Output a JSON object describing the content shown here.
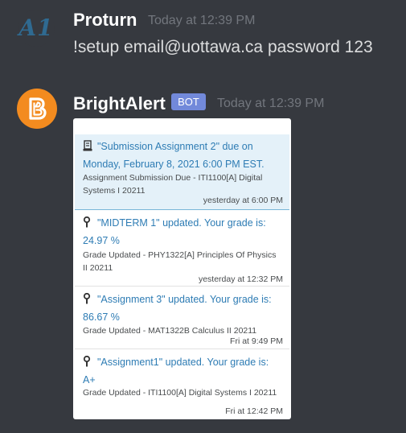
{
  "messages": [
    {
      "avatar_text": "A1",
      "author": "Proturn",
      "timestamp": "Today at 12:39 PM",
      "content": "!setup email@uottawa.ca password 123"
    },
    {
      "avatar_text": "B",
      "author": "BrightAlert",
      "tag": "BOT",
      "timestamp": "Today at 12:39 PM"
    }
  ],
  "notifications": [
    {
      "icon": "assignment-icon",
      "title": "\"Submission Assignment 2\" due on Monday, February 8, 2021 6:00 PM EST.",
      "description": "Assignment Submission Due - ITI1100[A] Digital Systems I 20211",
      "time": "yesterday at 6:00 PM"
    },
    {
      "icon": "grade-icon",
      "title": "\"MIDTERM 1\" updated. Your grade is: 24.97 %",
      "description": "Grade Updated - PHY1322[A] Principles Of Physics II 20211",
      "time": "yesterday at 12:32 PM"
    },
    {
      "icon": "grade-icon",
      "title": "\"Assignment 3\" updated. Your grade is: 86.67 %",
      "description": "Grade Updated - MAT1322B Calculus II 20211",
      "time": "Fri at 9:49 PM"
    },
    {
      "icon": "grade-icon",
      "title": "\"Assignment1\" updated. Your grade is: A+",
      "description": "Grade Updated - ITI1100[A] Digital Systems I 20211",
      "time": "Fri at 12:42 PM"
    }
  ],
  "colors": {
    "background": "#36393f",
    "bot_tag": "#7289da",
    "brightspace_orange": "#f38b1f",
    "link_blue": "#2e7cb4",
    "highlight": "#e4f1f9"
  }
}
